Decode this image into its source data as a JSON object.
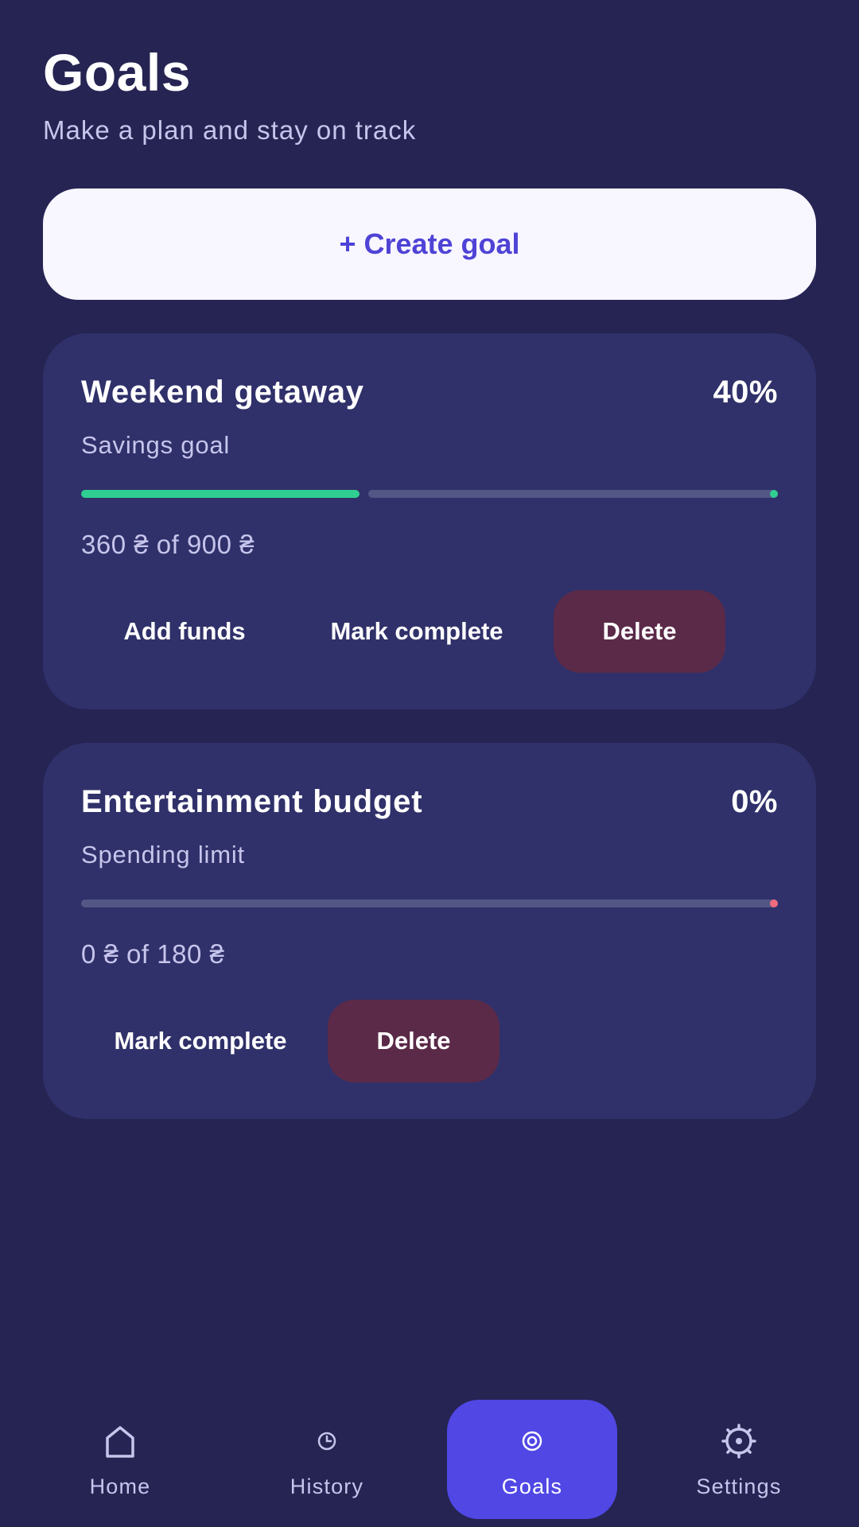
{
  "header": {
    "title": "Goals",
    "subtitle": "Make a plan and stay on track"
  },
  "create_button": {
    "label": "+ Create goal"
  },
  "goals": [
    {
      "title": "Weekend getaway",
      "percent_label": "40%",
      "progress_fraction": 0.4,
      "kind": "Savings goal",
      "amount": "360 ₴ of 900 ₴",
      "fill_color": "#2fcf91",
      "dot_color": "#2fcf91",
      "actions": {
        "add_funds": "Add funds",
        "mark_complete": "Mark complete",
        "delete": "Delete"
      }
    },
    {
      "title": "Entertainment budget",
      "percent_label": "0%",
      "progress_fraction": 0.0,
      "kind": "Spending limit",
      "amount": "0 ₴ of 180 ₴",
      "dot_color": "#f06b7e",
      "actions": {
        "mark_complete": "Mark complete",
        "delete": "Delete"
      }
    }
  ],
  "nav": {
    "items": [
      {
        "label": "Home",
        "icon": "home-icon",
        "active": false
      },
      {
        "label": "History",
        "icon": "clock-icon",
        "active": false
      },
      {
        "label": "Goals",
        "icon": "target-icon",
        "active": true
      },
      {
        "label": "Settings",
        "icon": "gear-icon",
        "active": false
      }
    ]
  },
  "colors": {
    "background": "#252453",
    "card": "#30316a",
    "accent": "#5047e5",
    "danger_button": "#5b2a48",
    "progress_green": "#2fcf91",
    "progress_red": "#f06b7e"
  }
}
